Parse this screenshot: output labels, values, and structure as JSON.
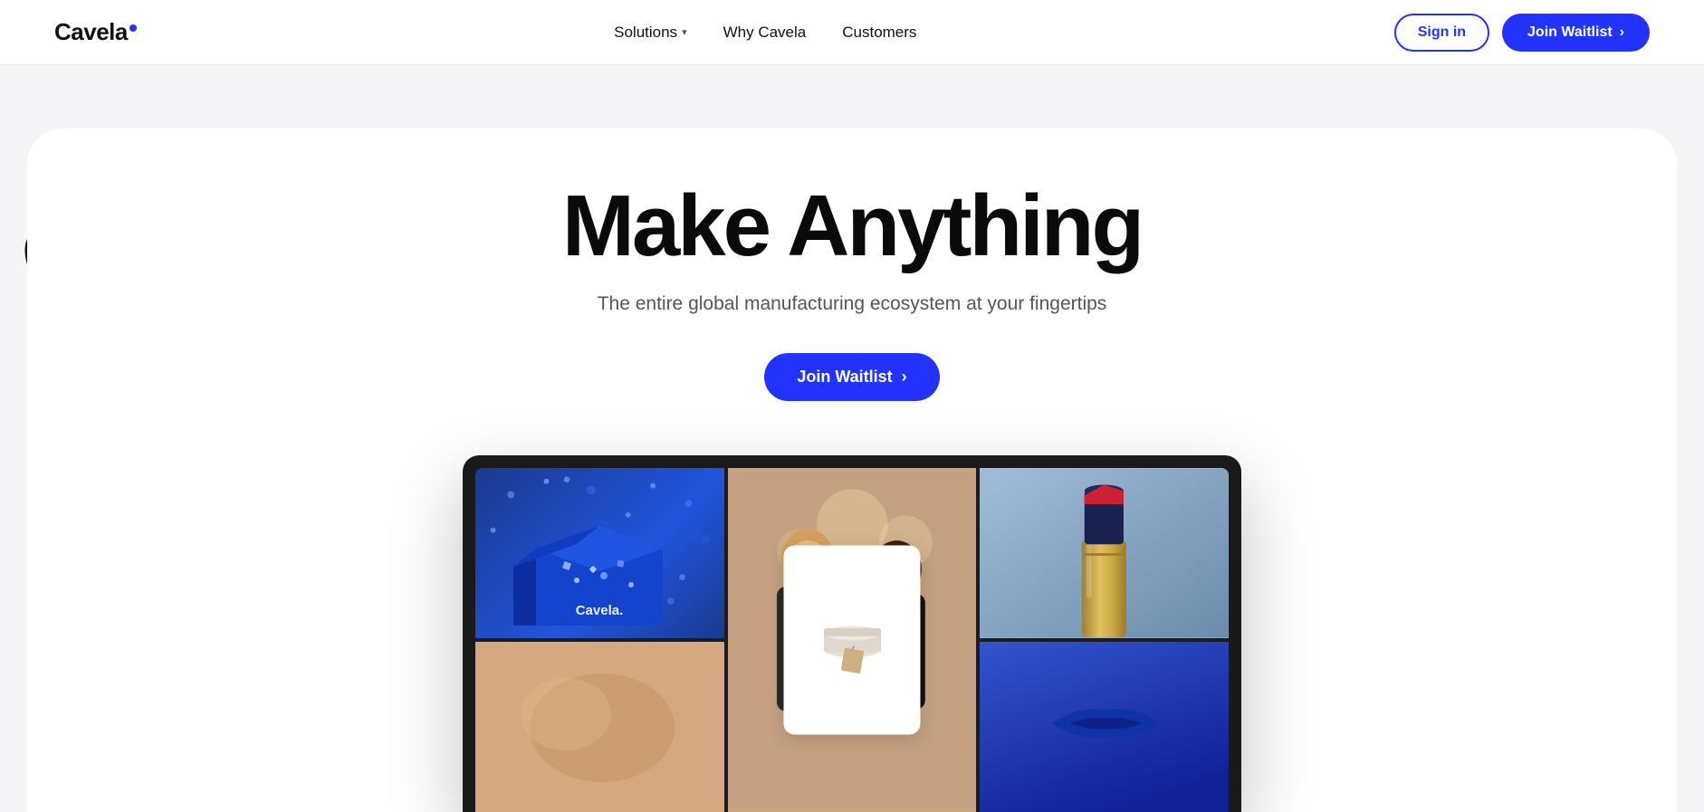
{
  "navbar": {
    "logo_text": "Cavela",
    "nav_items": [
      {
        "label": "Solutions",
        "has_dropdown": true
      },
      {
        "label": "Why Cavela",
        "has_dropdown": false
      },
      {
        "label": "Customers",
        "has_dropdown": false
      }
    ],
    "signin_label": "Sign in",
    "waitlist_label": "Join Waitlist",
    "waitlist_arrow": "›"
  },
  "hero": {
    "title": "Make Anything",
    "subtitle": "The entire global manufacturing ecosystem at your fingertips",
    "cta_label": "Join Waitlist",
    "cta_arrow": "›"
  },
  "decorative": {
    "hand_left_desc": "hand-holding-blue-tube-icon",
    "hand_right_desc": "hand-holding-blue-pen-icon"
  }
}
